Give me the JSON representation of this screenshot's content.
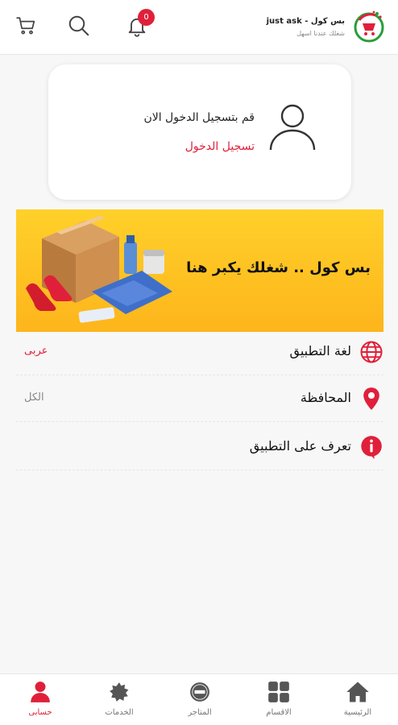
{
  "header": {
    "brand_title": "بس كول - just ask",
    "brand_subtitle": "شغلك عندنا اسهل",
    "notification_count": "0",
    "icons": [
      "cart-icon",
      "search-icon",
      "bell-icon"
    ]
  },
  "login_card": {
    "prompt": "قم بتسجيل الدخول الان",
    "link": "تسجيل الدخول"
  },
  "banner": {
    "text": "بس كول .. شغلك يكبر هنا"
  },
  "settings": {
    "language": {
      "label": "لغة التطبيق",
      "value": "عربى",
      "icon": "globe-icon"
    },
    "governorate": {
      "label": "المحافظة",
      "value": "الكل",
      "icon": "location-pin-icon"
    },
    "about": {
      "label": "تعرف على التطبيق",
      "icon": "info-icon"
    }
  },
  "bottom_nav": {
    "items": [
      {
        "label": "الرئيسية",
        "icon": "home-icon"
      },
      {
        "label": "الاقسام",
        "icon": "grid-icon"
      },
      {
        "label": "المتاجر",
        "icon": "store-badge-icon"
      },
      {
        "label": "الخدمات",
        "icon": "services-icon"
      },
      {
        "label": "حسابى",
        "icon": "account-icon",
        "active": true
      }
    ]
  },
  "colors": {
    "accent": "#e0203a",
    "banner_yellow": "#fdb51b",
    "icon_grey": "#555555"
  }
}
